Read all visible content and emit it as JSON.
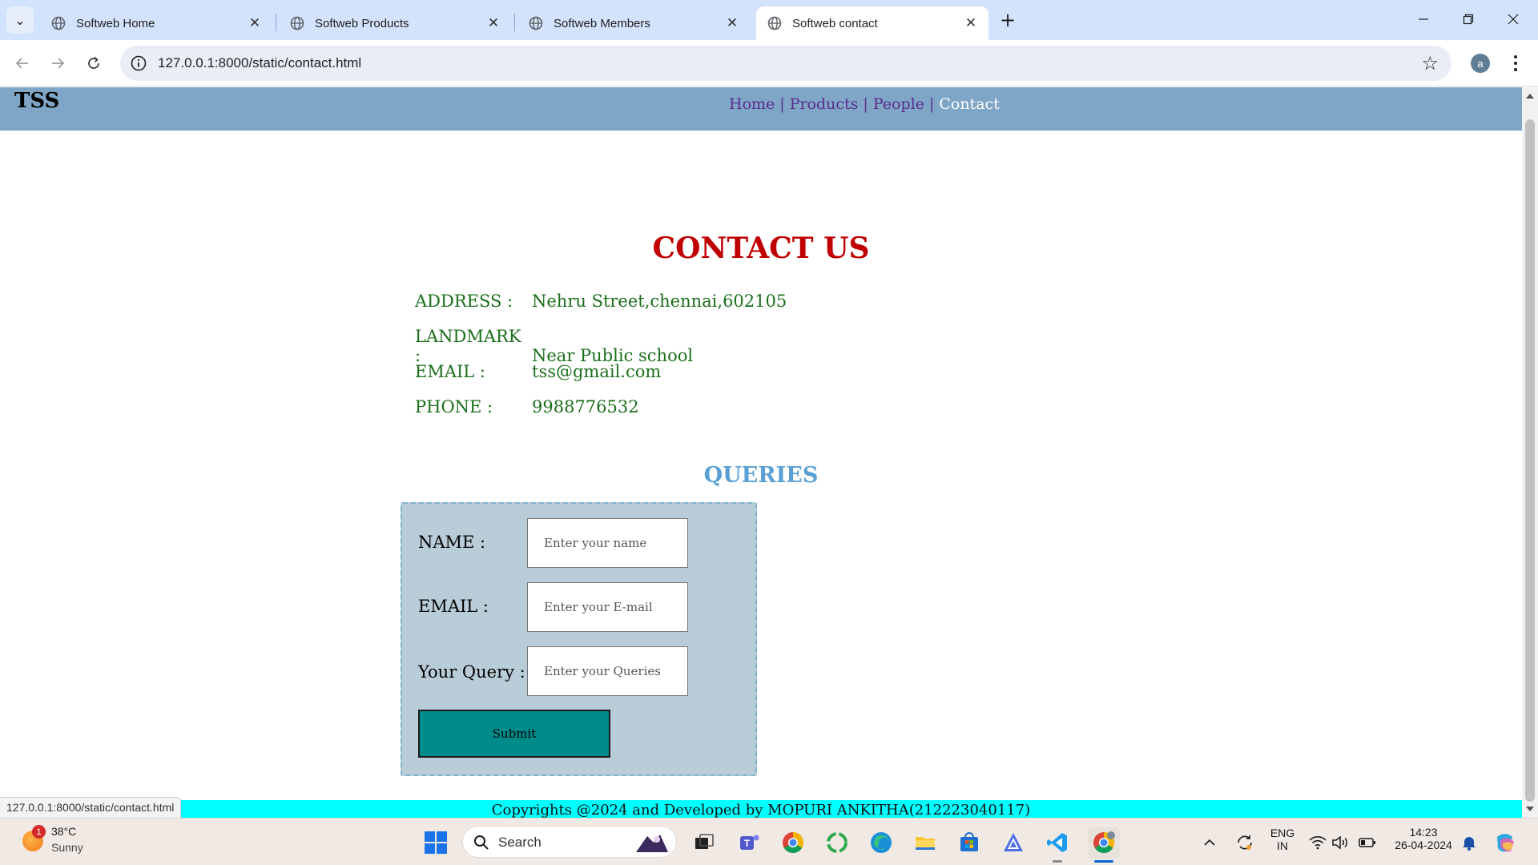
{
  "browser": {
    "tabs": [
      {
        "title": "Softweb Home",
        "active": false
      },
      {
        "title": "Softweb Products",
        "active": false
      },
      {
        "title": "Softweb Members",
        "active": false
      },
      {
        "title": "Softweb contact",
        "active": true
      }
    ],
    "url": "127.0.0.1:8000/static/contact.html",
    "profile_initial": "a",
    "status_url": "127.0.0.1:8000/static/contact.html"
  },
  "site": {
    "logo": "TSS",
    "nav": [
      {
        "label": "Home",
        "current": false
      },
      {
        "label": "Products",
        "current": false
      },
      {
        "label": "People",
        "current": false
      },
      {
        "label": "Contact",
        "current": true
      }
    ],
    "nav_separator": "|",
    "contact_title": "CONTACT US",
    "contact_info": [
      {
        "label": "ADDRESS :",
        "value": "Nehru Street,chennai,602105"
      },
      {
        "label": "LANDMARK :",
        "value": "Near Public school"
      },
      {
        "label": "EMAIL :",
        "value": "tss@gmail.com"
      },
      {
        "label": "PHONE :",
        "value": "9988776532"
      }
    ],
    "queries_title": "QUERIES",
    "form": {
      "name_label": "NAME :",
      "name_placeholder": "Enter your name",
      "email_label": "EMAIL :",
      "email_placeholder": "Enter your E-mail",
      "query_label": "Your Query :",
      "query_placeholder": "Enter your Queries",
      "submit_label": "Submit"
    },
    "footer": "Copyrights @2024 and Developed by MOPURI ANKITHA(212223040117)"
  },
  "taskbar": {
    "weather": {
      "temp": "38°C",
      "condition": "Sunny",
      "badge": "1"
    },
    "search_placeholder": "Search",
    "language": {
      "line1": "ENG",
      "line2": "IN"
    },
    "clock": {
      "time": "14:23",
      "date": "26-04-2024"
    }
  },
  "colors": {
    "header_bg": "#7fa6c7",
    "title_red": "#c00000",
    "info_green": "#1b6f1b",
    "queries_blue": "#5aa0d4",
    "form_bg": "#b9cdd8",
    "submit_bg": "#008b8b",
    "footer_bg": "#00ffff"
  }
}
